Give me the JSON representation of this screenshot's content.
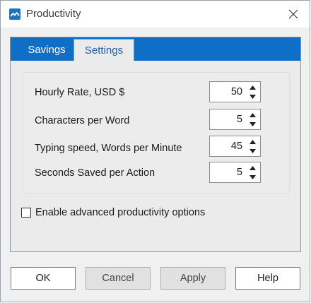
{
  "window": {
    "title": "Productivity",
    "accent_color": "#0f6fc6",
    "icons": {
      "app": "productivity-app-icon",
      "close": "close-icon"
    }
  },
  "tabs": [
    {
      "label": "Savings",
      "selected": false
    },
    {
      "label": "Settings",
      "selected": true
    }
  ],
  "settings": {
    "rows": [
      {
        "label": "Hourly Rate, USD $",
        "value": "50"
      },
      {
        "label": "Characters per Word",
        "value": "5"
      },
      {
        "label": "Typing speed, Words per Minute",
        "value": "45"
      },
      {
        "label": "Seconds Saved per Action",
        "value": "5"
      }
    ],
    "advanced": {
      "label": "Enable advanced productivity options",
      "checked": false
    }
  },
  "buttons": {
    "ok": "OK",
    "cancel": "Cancel",
    "apply": "Apply",
    "help": "Help"
  }
}
